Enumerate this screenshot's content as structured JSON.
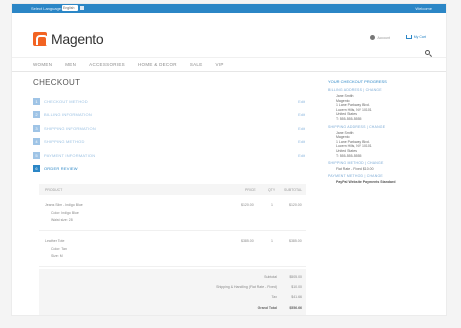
{
  "topbar": {
    "language_label": "Select Language:",
    "language_value": "English",
    "right_link": "Welcome"
  },
  "header": {
    "logo_text": "Magento",
    "account_label": "Account",
    "cart_label": "My Cart"
  },
  "nav": {
    "items": [
      "WOMEN",
      "MEN",
      "ACCESSORIES",
      "HOME & DECOR",
      "SALE",
      "VIP"
    ]
  },
  "page_title": "CHECKOUT",
  "steps": [
    {
      "num": "1",
      "label": "CHECKOUT METHOD",
      "edit": "Edit"
    },
    {
      "num": "2",
      "label": "BILLING INFORMATION",
      "edit": "Edit"
    },
    {
      "num": "3",
      "label": "SHIPPING INFORMATION",
      "edit": "Edit"
    },
    {
      "num": "4",
      "label": "SHIPPING METHOD",
      "edit": "Edit"
    },
    {
      "num": "5",
      "label": "PAYMENT INFORMATION",
      "edit": "Edit"
    },
    {
      "num": "6",
      "label": "ORDER REVIEW",
      "edit": ""
    }
  ],
  "order_table": {
    "headers": {
      "product": "PRODUCT",
      "price": "PRICE",
      "qty": "QTY",
      "subtotal": "SUBTOTAL"
    },
    "rows": [
      {
        "name": "Jeans Slim - Indigo Blue",
        "opt1": "Color: Indigo Blue",
        "opt2": "Waist size: 28",
        "price": "$120.00",
        "qty": "1",
        "subtotal": "$120.00"
      },
      {
        "name": "Leather Tote",
        "opt1": "Color: Tan",
        "opt2": "Size: M",
        "price": "$385.00",
        "qty": "1",
        "subtotal": "$385.00"
      }
    ]
  },
  "totals": {
    "subtotal": {
      "label": "Subtotal",
      "value": "$505.00"
    },
    "shipping": {
      "label": "Shipping & Handling (Flat Rate - Fixed)",
      "value": "$10.00"
    },
    "tax": {
      "label": "Tax",
      "value": "$41.66"
    },
    "grand": {
      "label": "Grand Total",
      "value": "$556.66"
    }
  },
  "sidebar": {
    "heading": "YOUR CHECKOUT PROGRESS",
    "billing": {
      "title": "BILLING ADDRESS | CHANGE",
      "lines": [
        "Jane Smith",
        "Magento",
        "1 Lane Parkway Blvd.",
        "Lucern Hills, NY 10101",
        "United States",
        "T: 555-555-5555"
      ]
    },
    "shipping": {
      "title": "SHIPPING ADDRESS | CHANGE",
      "lines": [
        "Jane Smith",
        "Magento",
        "1 Lane Parkway Blvd.",
        "Lucern Hills, NY 10101",
        "United States",
        "T: 555-555-5555"
      ]
    },
    "shipping_method": {
      "title": "SHIPPING METHOD | CHANGE",
      "value": "Flat Rate - Fixed $10.00"
    },
    "payment_method": {
      "title": "PAYMENT METHOD | CHANGE",
      "value": "PayPal Website Payments Standard"
    }
  }
}
